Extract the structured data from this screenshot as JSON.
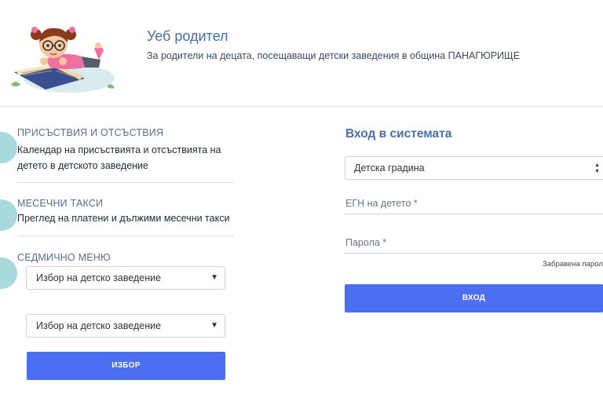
{
  "header": {
    "title": "Уеб родител",
    "subtitle": "За родители на децата, посещаващи детски заведения в община ПАНАГЮРИЩЕ"
  },
  "features": [
    {
      "title": "ПРИСЪСТВИЯ И ОТСЪСТВИЯ",
      "description_line1": "Календар на присъствията и отсъствията на",
      "description_line2": "детето в детското заведение"
    },
    {
      "title": "МЕСЕЧНИ ТАКСИ",
      "description_line1": "Преглед на платени и дължими месечни такси"
    },
    {
      "title": "СЕДМИЧНО МЕНЮ",
      "select1": "Избор на детско заведение",
      "select2": "Избор на детско заведение",
      "button": "ИЗБОР"
    }
  ],
  "login": {
    "title": "Вход в системата",
    "institution_type": "Детска градина",
    "egn_label": "ЕГН на детето *",
    "password_label": "Парола *",
    "forgot": "Забравена парол",
    "submit": "ВХОД"
  },
  "colors": {
    "accent": "#4c6ef0",
    "title": "#4a6fa5",
    "circle": "#a9d8dd"
  }
}
